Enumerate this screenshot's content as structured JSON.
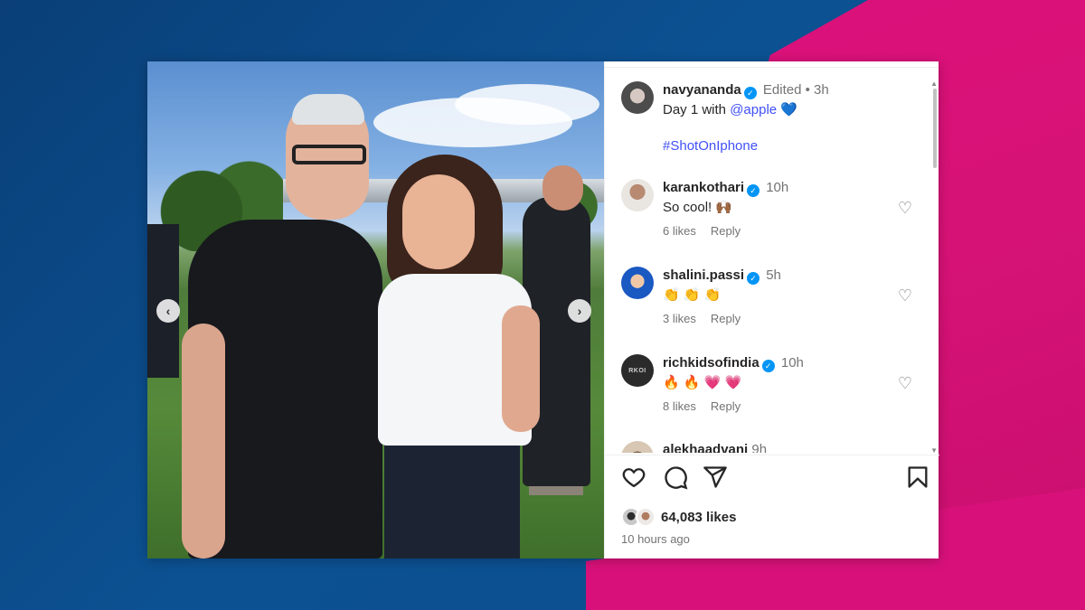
{
  "colors": {
    "background_blue": "#0b4f8f",
    "background_pink": "#d8117a",
    "link": "#4150f7",
    "verified": "#0095f6"
  },
  "post": {
    "author": "navyananda",
    "edited": "Edited",
    "dot": "•",
    "time": "3h",
    "caption": "Day 1 with",
    "mention": "@apple",
    "caption_emoji": "💙",
    "hashtag": "#ShotOnIphone"
  },
  "comments": [
    {
      "user": "karankothari",
      "time": "10h",
      "text": "So cool!",
      "emoji": "🙌🏾",
      "likes": "6 likes",
      "reply": "Reply",
      "avatar_icon": "avatar-karankothari"
    },
    {
      "user": "shalini.passi",
      "time": "5h",
      "text": "",
      "emoji": "👏 👏 👏",
      "likes": "3 likes",
      "reply": "Reply",
      "avatar_icon": "avatar-shalini"
    },
    {
      "user": "richkidsofindia",
      "time": "10h",
      "text": "",
      "emoji": "🔥 🔥 💗 💗",
      "likes": "8 likes",
      "reply": "Reply",
      "avatar_icon": "avatar-rkoi",
      "avatar_text": "RKOI"
    },
    {
      "user": "alekhaadvani",
      "time": "9h"
    }
  ],
  "footer": {
    "likes": "64,083 likes",
    "posted": "10 hours ago"
  },
  "icons": {
    "like": "heart-icon",
    "comment": "comment-icon",
    "share": "send-icon",
    "save": "bookmark-icon",
    "prev": "chevron-left-icon",
    "next": "chevron-right-icon"
  }
}
